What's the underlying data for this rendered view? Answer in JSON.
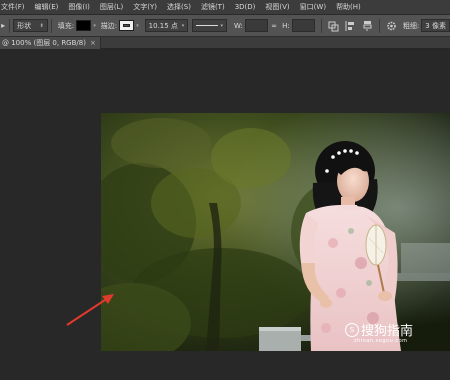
{
  "menubar": {
    "items": [
      "文件(F)",
      "编辑(E)",
      "图像(I)",
      "图层(L)",
      "文字(Y)",
      "选择(S)",
      "滤镜(T)",
      "3D(D)",
      "视图(V)",
      "窗口(W)",
      "帮助(H)"
    ]
  },
  "options": {
    "mode": "形状",
    "fill_label": "填充:",
    "stroke_label": "描边:",
    "stroke_size": "10.15 点",
    "w_label": "W:",
    "h_label": "H:",
    "link_symbol": "∞",
    "roughness_label": "粗细:",
    "roughness_value": "3 像素"
  },
  "document_tab": {
    "title": "@ 100% (图层 0, RGB/8)",
    "close": "×"
  },
  "watermark": {
    "text": "搜狗指南",
    "sub": "zhinan.sogou.com"
  },
  "colors": {
    "menubar_bg": "#3c3c3c",
    "options_bg": "#535353",
    "workspace_bg": "#282828",
    "arrow": "#e03a2c"
  }
}
